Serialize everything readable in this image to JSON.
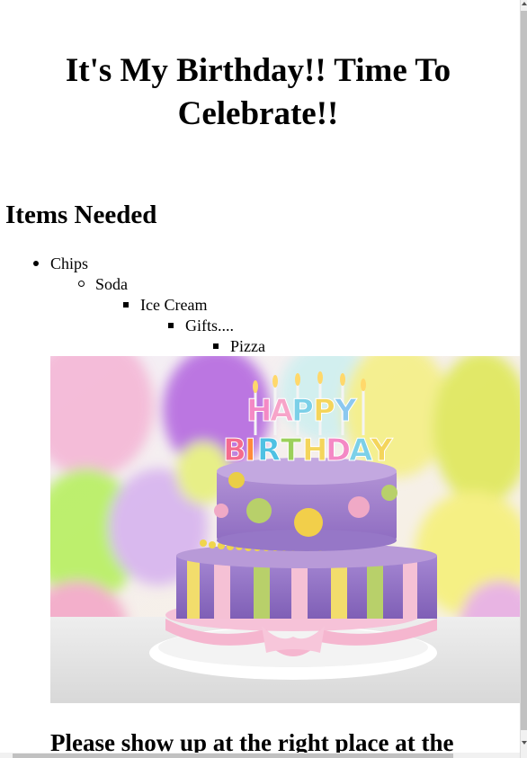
{
  "page": {
    "title": "It's My Birthday!! Time To Celebrate!!",
    "items_heading": "Items Needed",
    "items": [
      "Chips",
      "Soda",
      "Ice Cream",
      "Gifts....",
      "Pizza"
    ],
    "image": {
      "subject": "birthday-cake-icon",
      "caption_on_cake": "HAPPY BIRTHDAY"
    },
    "bottom_heading": "Please show up at the right place at the"
  },
  "colors": {
    "text": "#000000",
    "background": "#ffffff",
    "scrollbar_track": "#f1f1f1",
    "scrollbar_thumb": "#c1c1c1"
  }
}
